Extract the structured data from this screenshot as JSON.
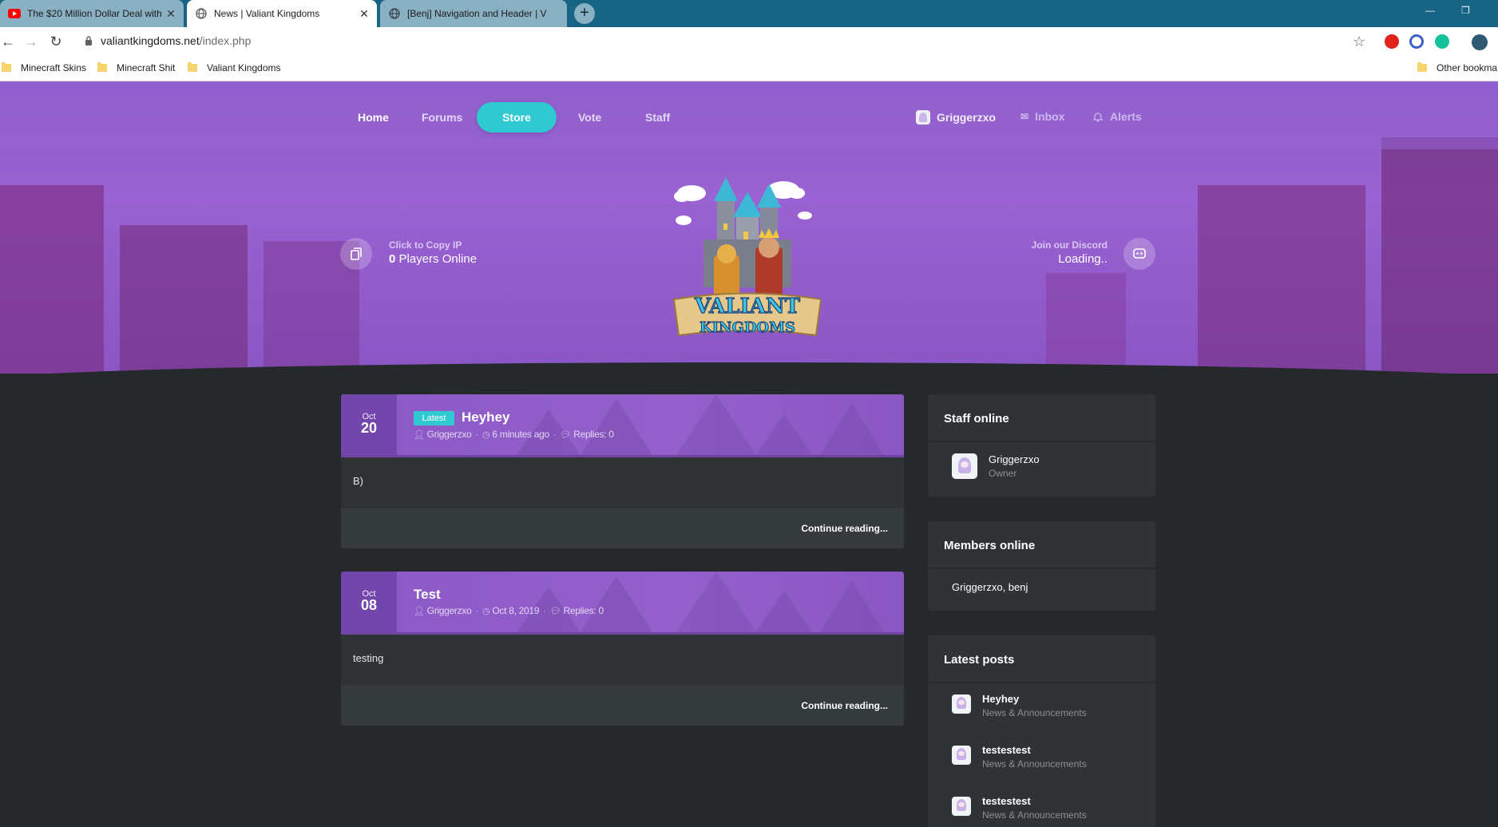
{
  "browser": {
    "tabs": [
      {
        "title": "The $20 Million Dollar Deal with",
        "favicon": "youtube-icon"
      },
      {
        "title": "News | Valiant Kingdoms",
        "favicon": "globe-icon"
      },
      {
        "title": "[Benj] Navigation and Header | V",
        "favicon": "globe-icon"
      }
    ],
    "address": {
      "host": "valiantkingdoms.net",
      "path": "/index.php"
    },
    "bookmarks": [
      "Minecraft Skins",
      "Minecraft Shit",
      "Valiant Kingdoms"
    ],
    "other_bookmarks": "Other bookma",
    "colors": {
      "tabstrip": "#176485",
      "accent_cyan": "#2fc9d2",
      "hero_purple": "#9a62d2",
      "page_bg": "#25292c"
    }
  },
  "nav": {
    "links": [
      "Home",
      "Forums",
      "Store",
      "Vote",
      "Staff"
    ],
    "user": "Griggerzxo",
    "inbox": "Inbox",
    "alerts": "Alerts"
  },
  "hero": {
    "copy_ip_label": "Click to Copy IP",
    "players_count": "0",
    "players_label": "Players Online",
    "discord_label": "Join our Discord",
    "discord_status": "Loading..",
    "logo_line1": "VALIANT",
    "logo_line2": "KINGDOMS"
  },
  "posts": [
    {
      "month": "Oct",
      "day": "20",
      "badge": "Latest",
      "title": "Heyhey",
      "author": "Griggerzxo",
      "time": "6 minutes ago",
      "replies": "Replies: 0",
      "body": "B)",
      "continue": "Continue reading..."
    },
    {
      "month": "Oct",
      "day": "08",
      "title": "Test",
      "author": "Griggerzxo",
      "time": "Oct 8, 2019",
      "replies": "Replies: 0",
      "body": "testing",
      "continue": "Continue reading..."
    }
  ],
  "sidebar": {
    "staff_title": "Staff online",
    "staff": [
      {
        "name": "Griggerzxo",
        "role": "Owner"
      }
    ],
    "members_title": "Members online",
    "members": "Griggerzxo, benj",
    "latest_title": "Latest posts",
    "latest": [
      {
        "title": "Heyhey",
        "forum": "News & Announcements"
      },
      {
        "title": "testestest",
        "forum": "News & Announcements"
      },
      {
        "title": "testestest",
        "forum": "News & Announcements"
      }
    ]
  }
}
